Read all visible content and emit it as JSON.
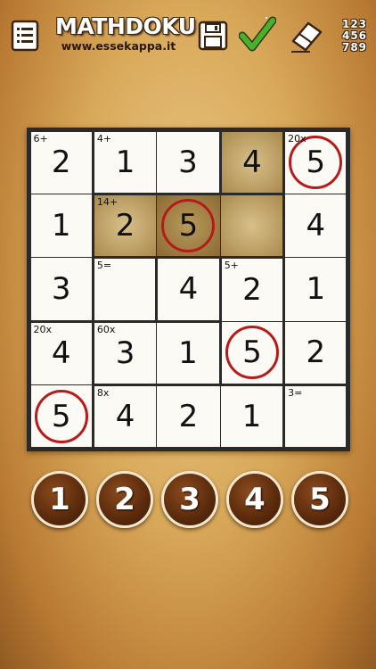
{
  "header": {
    "title": "MATHDOKU",
    "subtitle": "www.essekappa.it",
    "notes_rows": [
      "123",
      "456",
      "789"
    ]
  },
  "icons": {
    "menu": "list-menu-icon",
    "save": "floppy-disk-icon",
    "check": "checkmark-icon",
    "eraser": "eraser-icon"
  },
  "board": {
    "size": 5,
    "rows": [
      [
        {
          "value": "2",
          "clue": "6+"
        },
        {
          "value": "1",
          "clue": "4+"
        },
        {
          "value": "3",
          "clue": ""
        },
        {
          "value": "4",
          "clue": "",
          "shaded": true
        },
        {
          "value": "5",
          "clue": "20x",
          "circled": true
        }
      ],
      [
        {
          "value": "1",
          "clue": ""
        },
        {
          "value": "2",
          "clue": "14+",
          "shaded": true
        },
        {
          "value": "5",
          "clue": "",
          "selected": true,
          "circled": true
        },
        {
          "value": "",
          "clue": "",
          "shaded": true
        },
        {
          "value": "4",
          "clue": ""
        }
      ],
      [
        {
          "value": "3",
          "clue": ""
        },
        {
          "value": "",
          "clue": "5="
        },
        {
          "value": "4",
          "clue": ""
        },
        {
          "value": "2",
          "clue": "5+"
        },
        {
          "value": "1",
          "clue": ""
        }
      ],
      [
        {
          "value": "4",
          "clue": "20x"
        },
        {
          "value": "3",
          "clue": "60x"
        },
        {
          "value": "1",
          "clue": ""
        },
        {
          "value": "5",
          "clue": "",
          "circled": true
        },
        {
          "value": "2",
          "clue": ""
        }
      ],
      [
        {
          "value": "5",
          "clue": "",
          "circled": true
        },
        {
          "value": "4",
          "clue": "8x"
        },
        {
          "value": "2",
          "clue": ""
        },
        {
          "value": "1",
          "clue": ""
        },
        {
          "value": "",
          "clue": "3="
        }
      ]
    ]
  },
  "keypad": [
    "1",
    "2",
    "3",
    "4",
    "5"
  ],
  "colors": {
    "circle": "#b81a1a",
    "cage_border": "#2a2a2a",
    "keypad_bg": "#5a2a0c"
  }
}
